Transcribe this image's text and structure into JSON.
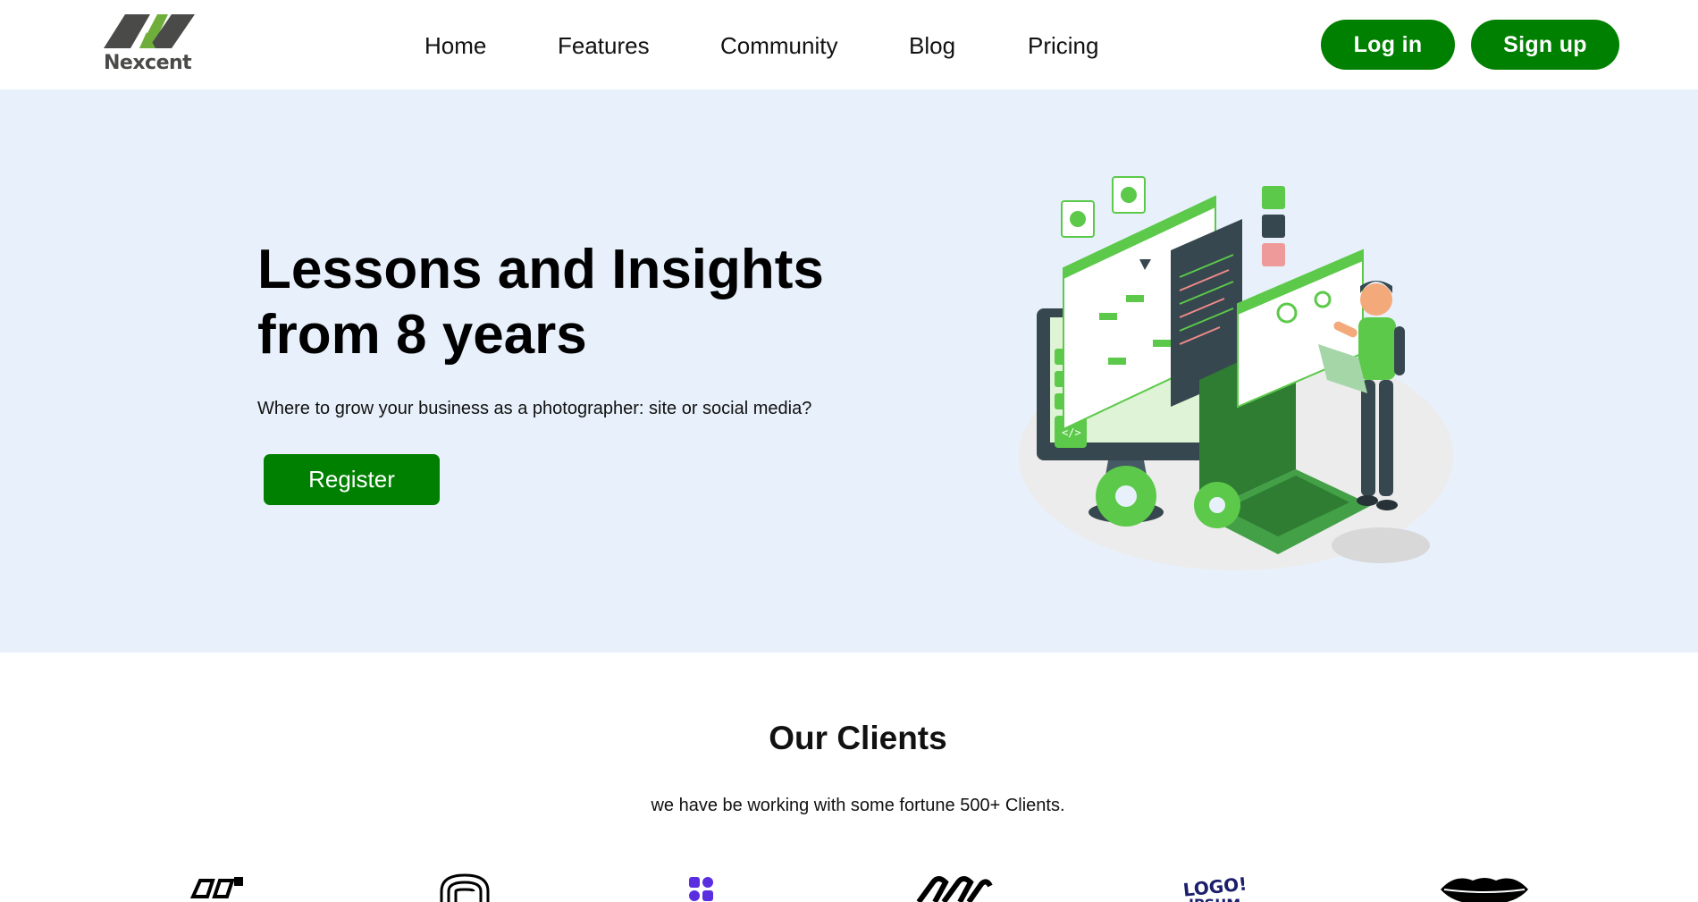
{
  "brand": {
    "name": "Nexcent",
    "accent": "#008000",
    "logo_dark": "#4a4a48",
    "logo_green": "#6fae3a"
  },
  "nav": {
    "items": [
      "Home",
      "Features",
      "Community",
      "Blog",
      "Pricing"
    ],
    "login_label": "Log in",
    "signup_label": "Sign up"
  },
  "hero": {
    "title": "Lessons and Insights from 8 years",
    "subtitle": "Where to grow your business as a photographer: site or social media?",
    "cta_label": "Register",
    "background": "#e8f1fb",
    "illustration": "developer-with-laptop-and-code-screens-illustration"
  },
  "clients": {
    "title": "Our Clients",
    "subtitle": "we have be working with some fortune 500+ Clients.",
    "logos": [
      "client-logo-1",
      "client-logo-2",
      "client-logo-3",
      "client-logo-4",
      "client-logo-logoipsum",
      "client-logo-lips"
    ]
  }
}
